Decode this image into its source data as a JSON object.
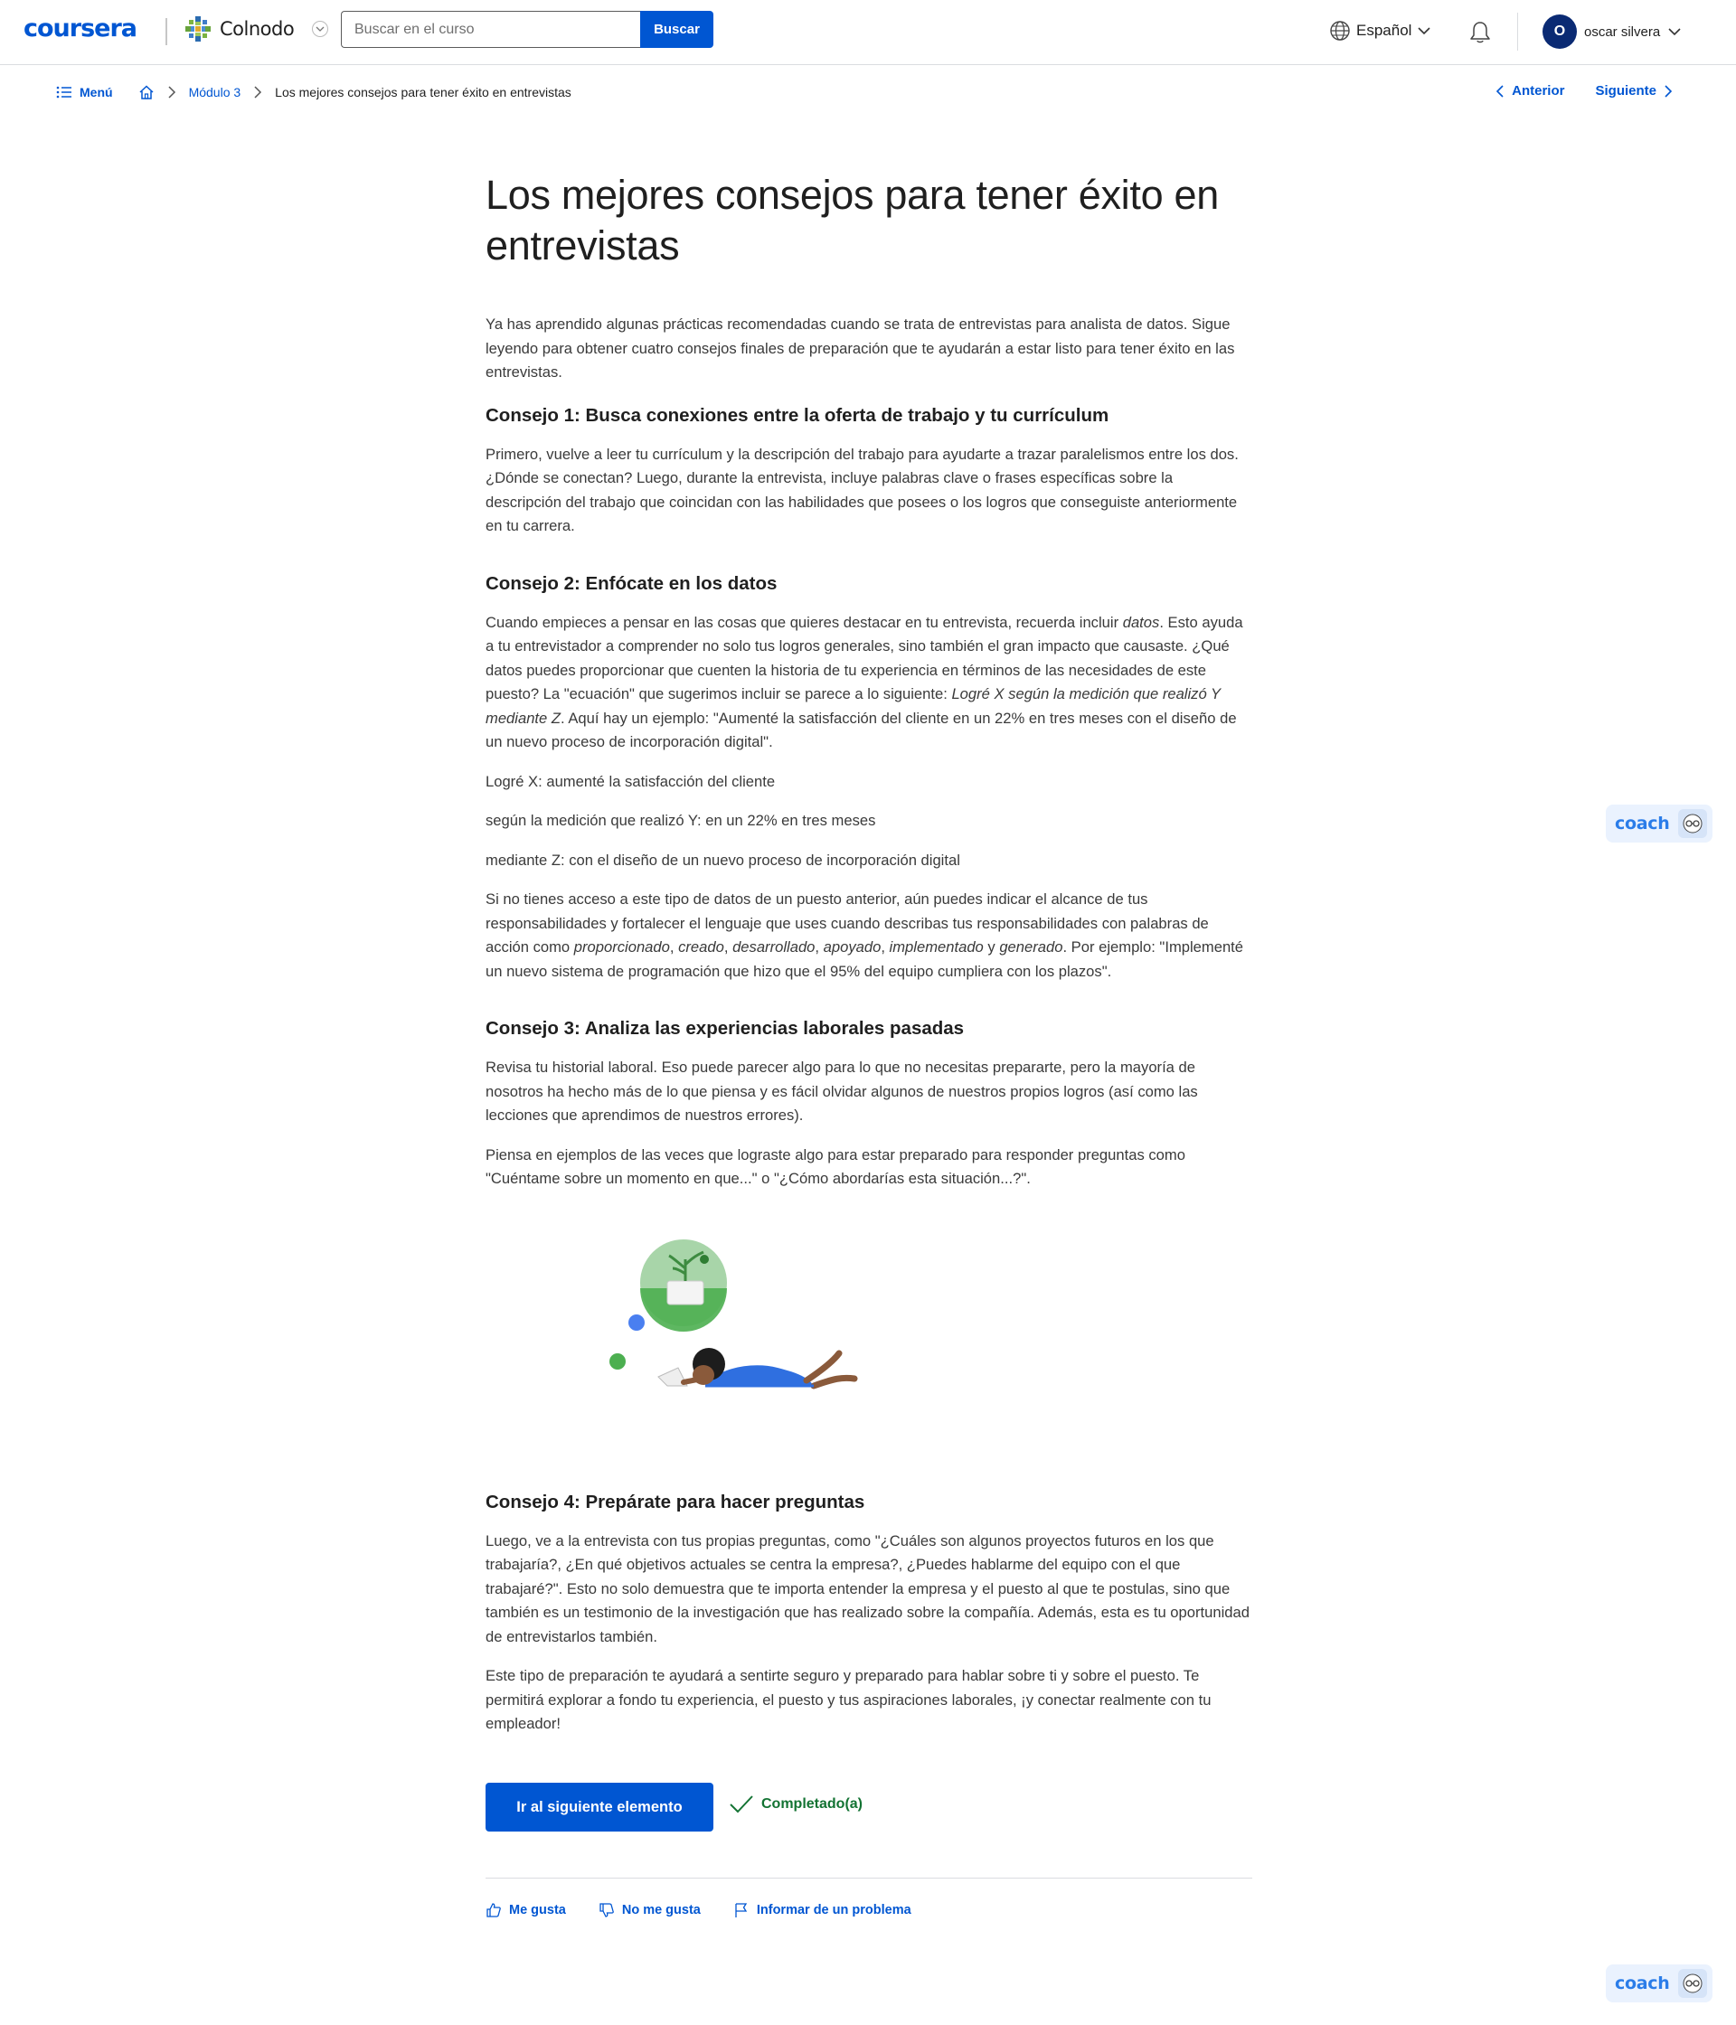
{
  "header": {
    "logo": "coursera",
    "partner": "Colnodo",
    "search_placeholder": "Buscar en el curso",
    "search_button": "Buscar",
    "language": "Español",
    "user_initial": "O",
    "user_name": "oscar silvera"
  },
  "breadcrumb": {
    "menu": "Menú",
    "module": "Módulo 3",
    "current": "Los mejores consejos para tener éxito en entrevistas"
  },
  "nav": {
    "prev": "Anterior",
    "next": "Siguiente"
  },
  "article": {
    "title": "Los mejores consejos para tener éxito en entrevistas",
    "intro": "Ya has aprendido algunas prácticas recomendadas cuando se trata de entrevistas para analista de datos. Sigue leyendo para obtener cuatro consejos finales de preparación que te ayudarán a estar listo para tener éxito en las entrevistas.",
    "tip1_title": "Consejo 1: Busca conexiones entre la oferta de trabajo y tu currículum",
    "tip1_p1": "Primero, vuelve a leer tu currículum y la descripción del trabajo para ayudarte a trazar paralelismos entre los dos. ¿Dónde se conectan? Luego, durante la entrevista, incluye palabras clave o frases específicas sobre la descripción del trabajo que coincidan con las habilidades que posees o los logros que conseguiste anteriormente en tu carrera.",
    "tip2_title": "Consejo 2: Enfócate en los datos",
    "tip2_p1_a": "Cuando empieces a pensar en las cosas que quieres destacar en tu entrevista, recuerda incluir ",
    "tip2_p1_b": "datos",
    "tip2_p1_c": ". Esto ayuda a tu entrevistador a comprender no solo tus logros generales, sino también el gran impacto que causaste. ¿Qué datos puedes proporcionar que cuenten la historia de tu experiencia en términos de las necesidades de este puesto? La \"ecuación\" que sugerimos incluir se parece a lo siguiente: ",
    "tip2_p1_d": "Logré X según la medición que realizó Y mediante Z",
    "tip2_p1_e": ". Aquí hay un ejemplo: \"Aumenté la satisfacción del cliente en un 22% en tres meses con el diseño de un nuevo proceso de incorporación digital\".",
    "tip2_x": "Logré X: aumenté la satisfacción del cliente",
    "tip2_y": "según la medición que realizó Y: en un 22% en tres meses",
    "tip2_z": "mediante Z: con el diseño de un nuevo proceso de incorporación digital",
    "tip2_p2_a": "Si no tienes acceso a este tipo de datos de un puesto anterior, aún puedes indicar el alcance de tus responsabilidades y fortalecer el lenguaje que uses cuando describas tus responsabilidades con palabras de acción como ",
    "tip2_p2_w1": "proporcionado",
    "tip2_p2_w2": "creado",
    "tip2_p2_w3": "desarrollado",
    "tip2_p2_w4": "apoyado",
    "tip2_p2_w5": "implementado",
    "tip2_p2_y": " y ",
    "tip2_p2_w6": "generado",
    "tip2_p2_b": ". Por ejemplo: \"Implementé un nuevo sistema de programación que hizo que el 95% del equipo cumpliera con los plazos\".",
    "tip3_title": "Consejo 3: Analiza las experiencias laborales pasadas",
    "tip3_p1": "Revisa tu historial laboral. Eso puede parecer algo para lo que no necesitas prepararte, pero la mayoría de nosotros ha hecho más de lo que piensa y es fácil olvidar algunos de nuestros propios logros (así como las lecciones que aprendimos de nuestros errores).",
    "tip3_p2": "Piensa en ejemplos de las veces que lograste algo para estar preparado para responder preguntas como \"Cuéntame sobre un momento en que...\" o \"¿Cómo abordarías esta situación...?\".",
    "tip4_title": "Consejo 4: Prepárate para hacer preguntas",
    "tip4_p1": "Luego, ve a la entrevista con tus propias preguntas, como \"¿Cuáles son algunos proyectos futuros en los que trabajaría?, ¿En qué objetivos actuales se centra la empresa?, ¿Puedes hablarme del equipo con el que trabajaré?\". Esto no solo demuestra que te importa entender la empresa y el puesto al que te postulas, sino que también es un testimonio de la investigación que has realizado sobre la compañía. Además, esta es tu oportunidad de entrevistarlos también.",
    "tip4_p2": "Este tipo de preparación te ayudará a sentirte seguro y preparado para hablar sobre ti y sobre el puesto. Te permitirá explorar a fondo tu experiencia, el puesto y tus aspiraciones laborales, ¡y conectar realmente con tu empleador!"
  },
  "actions": {
    "next_item": "Ir al siguiente elemento",
    "completed": "Completado(a)",
    "like": "Me gusta",
    "dislike": "No me gusta",
    "report": "Informar de un problema"
  },
  "coach": {
    "label": "coach"
  },
  "colors": {
    "accent": "#0056d2",
    "success": "#137333",
    "coach_bg": "#eaf2fe"
  }
}
